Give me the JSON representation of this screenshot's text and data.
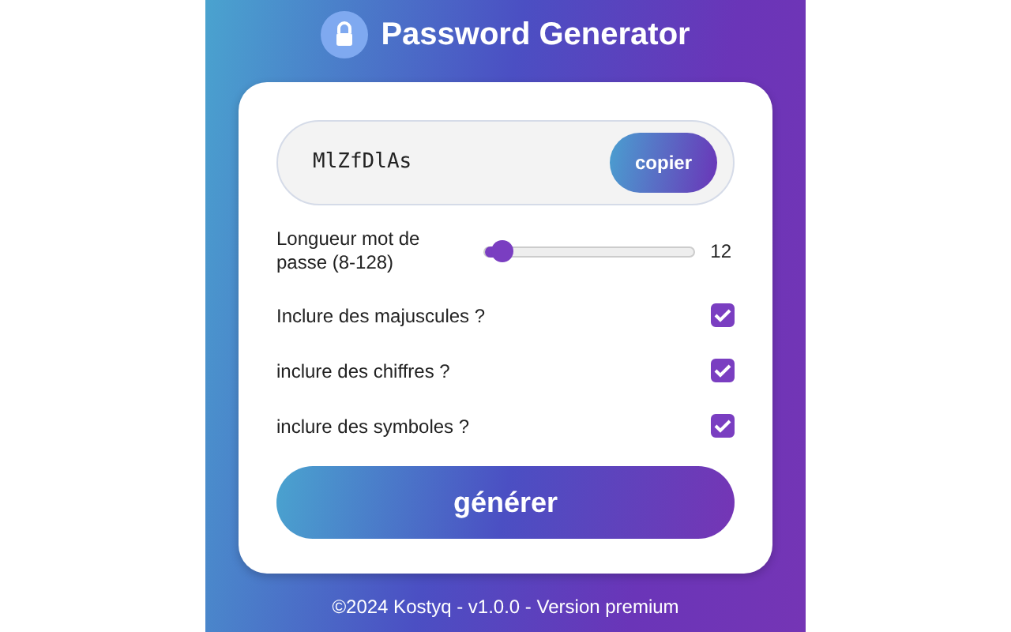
{
  "header": {
    "title": "Password Generator"
  },
  "password": {
    "value": "MlZfDlAs",
    "copy_button": "copier"
  },
  "length": {
    "label": "Longueur mot de passe (8-128)",
    "level": 0.033,
    "reading": "12"
  },
  "options": [
    {
      "label": "Inclure des majuscules ?",
      "checked": true
    },
    {
      "label": "inclure des chiffres ?",
      "checked": true
    },
    {
      "label": "inclure des symboles ?",
      "checked": true
    }
  ],
  "generate_button": "générer",
  "footer": "©2024 Kostyq - v1.0.0 - Version premium"
}
